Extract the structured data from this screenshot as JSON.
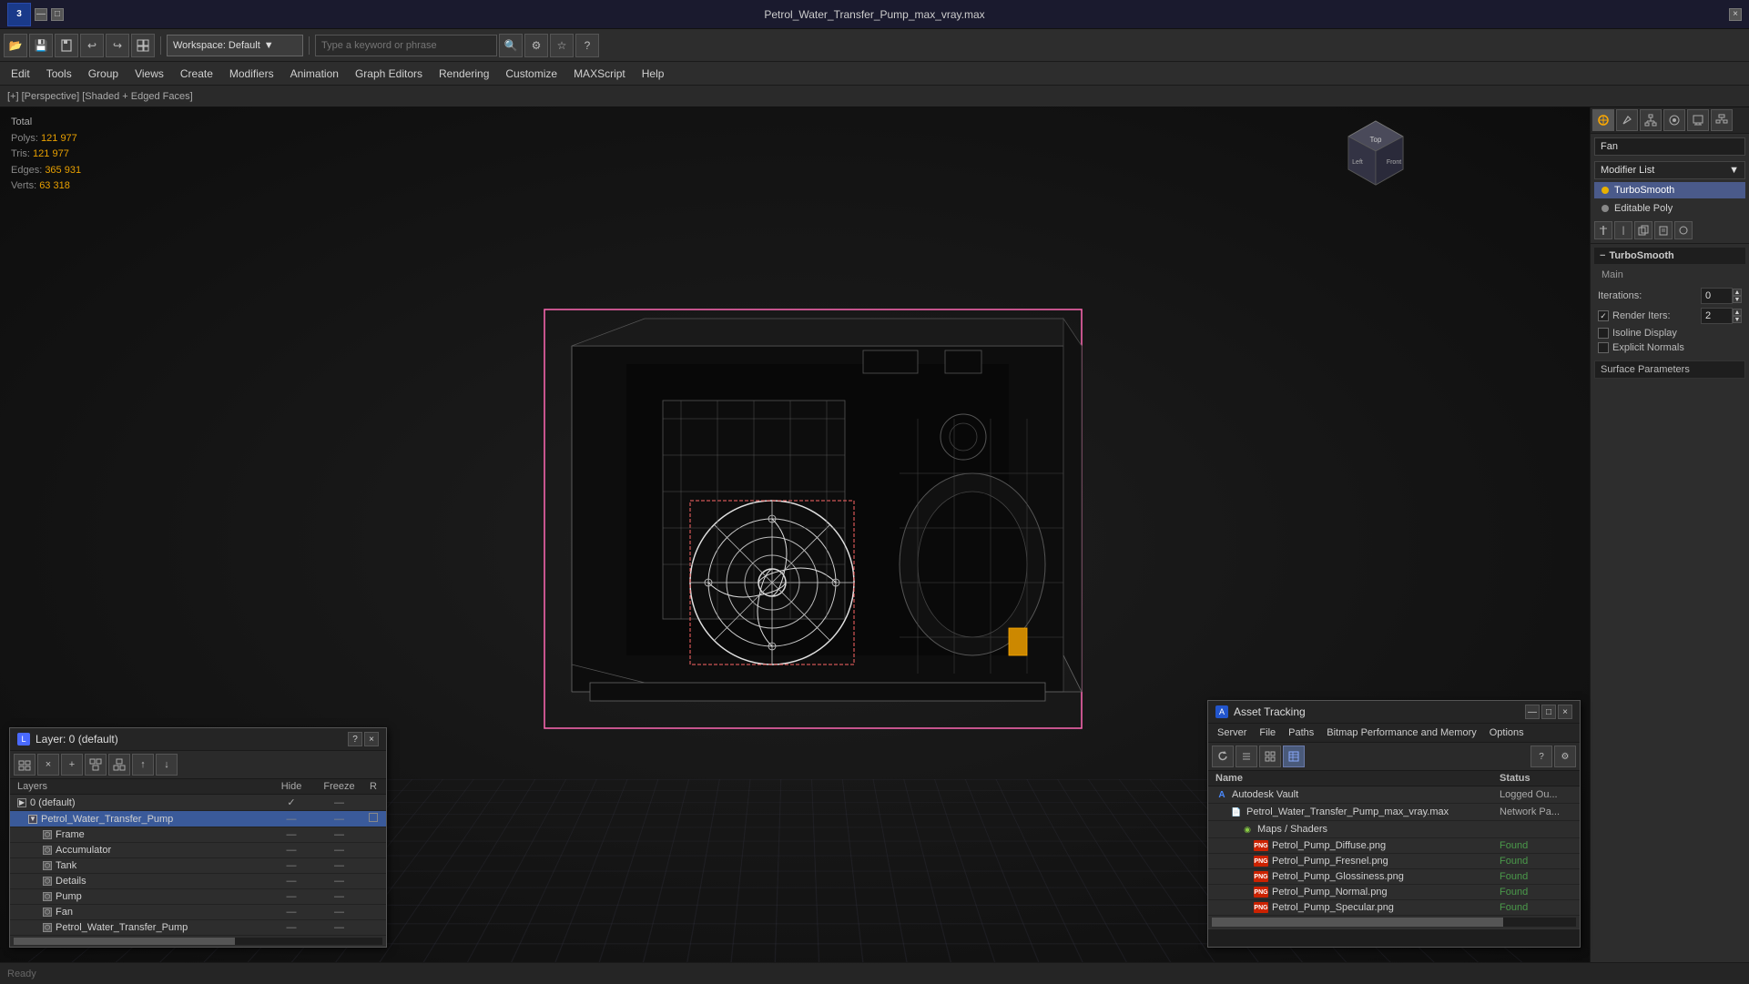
{
  "app": {
    "title": "Petrol_Water_Transfer_Pump_max_vray.max",
    "workspace": "Workspace: Default",
    "search_placeholder": "Type a keyword or phrase"
  },
  "menu": {
    "items": [
      "Edit",
      "Tools",
      "Group",
      "Views",
      "Create",
      "Modifiers",
      "Animation",
      "Graph Editors",
      "Rendering",
      "Customize",
      "MAXScript",
      "Help"
    ]
  },
  "viewport": {
    "label": "[+] [Perspective] [Shaded + Edged Faces]",
    "stats": {
      "polys_label": "Polys:",
      "polys_value": "121 977",
      "tris_label": "Tris:",
      "tris_value": "121 977",
      "edges_label": "Edges:",
      "edges_value": "365 931",
      "verts_label": "Verts:",
      "verts_value": "63 318",
      "total_label": "Total"
    }
  },
  "right_panel": {
    "object_name": "Fan",
    "modifier_list_label": "Modifier List",
    "modifiers": [
      {
        "name": "TurboSmooth",
        "active": true
      },
      {
        "name": "Editable Poly",
        "active": false
      }
    ],
    "turbosmooth": {
      "title": "TurboSmooth",
      "main_label": "Main",
      "iterations_label": "Iterations:",
      "iterations_value": "0",
      "render_iters_label": "Render Iters:",
      "render_iters_value": "2",
      "isoline_display_label": "Isoline Display",
      "explicit_normals_label": "Explicit Normals",
      "surface_params_label": "Surface Parameters"
    }
  },
  "layer_panel": {
    "title": "Layer: 0 (default)",
    "columns": {
      "name": "Layers",
      "hide": "Hide",
      "freeze": "Freeze",
      "r": "R"
    },
    "rows": [
      {
        "name": "0 (default)",
        "indent": 0,
        "checked": true,
        "hide": "—",
        "freeze": "—",
        "r": ""
      },
      {
        "name": "Petrol_Water_Transfer_Pump",
        "indent": 1,
        "selected": true,
        "hide": "—",
        "freeze": "—",
        "r": "□"
      },
      {
        "name": "Frame",
        "indent": 2,
        "hide": "—",
        "freeze": "—",
        "r": ""
      },
      {
        "name": "Accumulator",
        "indent": 2,
        "hide": "—",
        "freeze": "—",
        "r": ""
      },
      {
        "name": "Tank",
        "indent": 2,
        "hide": "—",
        "freeze": "—",
        "r": ""
      },
      {
        "name": "Details",
        "indent": 2,
        "hide": "—",
        "freeze": "—",
        "r": ""
      },
      {
        "name": "Pump",
        "indent": 2,
        "hide": "—",
        "freeze": "—",
        "r": ""
      },
      {
        "name": "Fan",
        "indent": 2,
        "hide": "—",
        "freeze": "—",
        "r": ""
      },
      {
        "name": "Petrol_Water_Transfer_Pump",
        "indent": 2,
        "hide": "—",
        "freeze": "—",
        "r": ""
      }
    ]
  },
  "asset_panel": {
    "title": "Asset Tracking",
    "menu_items": [
      "Server",
      "File",
      "Paths",
      "Bitmap Performance and Memory",
      "Options"
    ],
    "columns": {
      "name": "Name",
      "status": "Status"
    },
    "rows": [
      {
        "name": "Autodesk Vault",
        "indent": 0,
        "type": "autodesk",
        "status": "Logged Ou..."
      },
      {
        "name": "Petrol_Water_Transfer_Pump_max_vray.max",
        "indent": 1,
        "type": "file",
        "status": "Network Pa..."
      },
      {
        "name": "Maps / Shaders",
        "indent": 2,
        "type": "maps",
        "status": ""
      },
      {
        "name": "Petrol_Pump_Diffuse.png",
        "indent": 3,
        "type": "png",
        "status": "Found"
      },
      {
        "name": "Petrol_Pump_Fresnel.png",
        "indent": 3,
        "type": "png",
        "status": "Found"
      },
      {
        "name": "Petrol_Pump_Glossiness.png",
        "indent": 3,
        "type": "png",
        "status": "Found"
      },
      {
        "name": "Petrol_Pump_Normal.png",
        "indent": 3,
        "type": "png",
        "status": "Found"
      },
      {
        "name": "Petrol_Pump_Specular.png",
        "indent": 3,
        "type": "png",
        "status": "Found"
      }
    ]
  },
  "icons": {
    "app": "3",
    "open": "📂",
    "save": "💾",
    "undo": "↩",
    "redo": "↪",
    "plus": "+",
    "minus": "−",
    "close": "×",
    "check": "✓",
    "gear": "⚙",
    "sun": "☀",
    "camera": "📷",
    "grid": "⊞",
    "help": "?",
    "search": "🔍"
  },
  "colors": {
    "accent_blue": "#3a5a9a",
    "accent_yellow": "#e8a000",
    "found_green": "#4a9a4a",
    "selection_pink": "#ff69b4",
    "bg_dark": "#1a1a1a",
    "bg_medium": "#2d2d2d",
    "bg_light": "#3a3a3a"
  }
}
